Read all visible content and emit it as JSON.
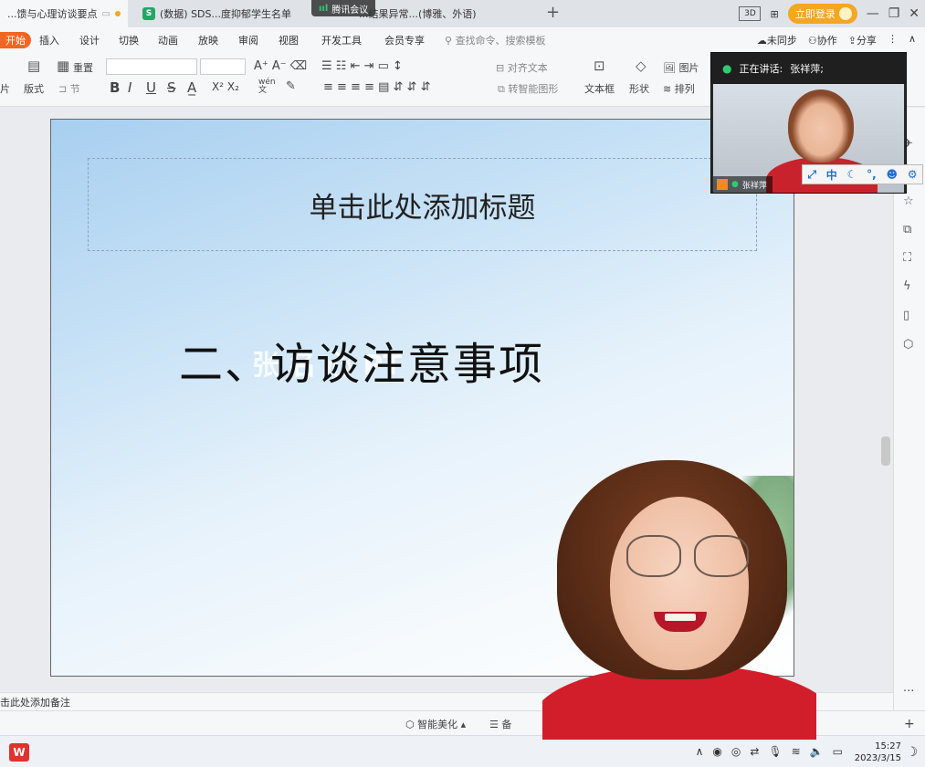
{
  "tabs": [
    {
      "label": "...馈与心理访谈要点",
      "pin": "▭",
      "active": true
    },
    {
      "label": "(数据) SDS...度抑郁学生名单",
      "icon": "S",
      "active": false
    },
    {
      "label": "...结果异常...(博雅、外语)",
      "active": false
    }
  ],
  "meeting_float": {
    "label": "腾讯会议"
  },
  "title_right": {
    "login": "立即登录"
  },
  "menu": {
    "start": "开始",
    "items": [
      "插入",
      "设计",
      "切换",
      "动画",
      "放映",
      "审阅",
      "视图",
      "开发工具",
      "会员专享"
    ],
    "search_placeholder": "查找命令、搜索模板",
    "right": [
      "未同步",
      "协作",
      "分享"
    ]
  },
  "ribbon": {
    "reset": "重置",
    "layout": "版式",
    "section": "节",
    "align_text": "对齐文本",
    "smart_shape": "转智能图形",
    "textbox": "文本框",
    "shape": "形状",
    "picture": "图片",
    "arrange": "排列",
    "pinyin": "wén",
    "partial_left": "片"
  },
  "slide": {
    "title_placeholder": "单击此处添加标题",
    "heading": "二、访谈注意事项",
    "ghost": "张       名     心             PT"
  },
  "notes": {
    "placeholder": "击此处添加备注"
  },
  "status": {
    "beautify": "智能美化",
    "notes_partial": "备"
  },
  "meeting": {
    "speaking_label": "正在讲话:",
    "speaker_name": "张祥萍;",
    "tile_name": "张祥萍"
  },
  "ime": {
    "mode": "中"
  },
  "taskbar": {
    "time": "15:27",
    "date": "2023/3/15"
  }
}
